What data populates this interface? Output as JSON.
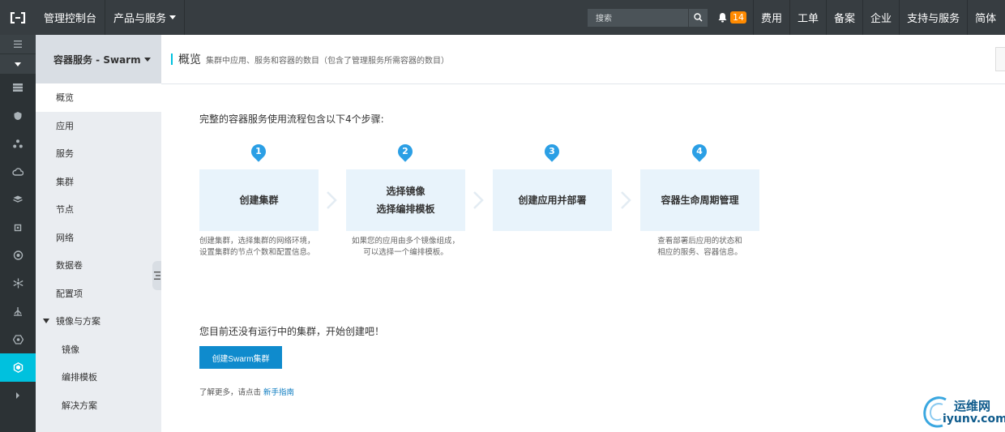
{
  "topbar": {
    "console": "管理控制台",
    "products": "产品与服务",
    "search_placeholder": "搜索",
    "notification_count": "14",
    "links": [
      "费用",
      "工单",
      "备案",
      "企业",
      "支持与服务",
      "简体"
    ]
  },
  "sidebar": {
    "title": "容器服务 - Swarm",
    "items": [
      "概览",
      "应用",
      "服务",
      "集群",
      "节点",
      "网络",
      "数据卷",
      "配置项"
    ],
    "group": "镜像与方案",
    "sub_items": [
      "镜像",
      "编排模板",
      "解决方案"
    ]
  },
  "page": {
    "title": "概览",
    "description": "集群中应用、服务和容器的数目（包含了管理服务所需容器的数目）"
  },
  "content": {
    "intro": "完整的容器服务使用流程包含以下4个步骤:",
    "steps": [
      {
        "num": "1",
        "title_lines": [
          "创建集群"
        ],
        "desc_lines": [
          "创建集群，选择集群的网络环境，",
          "设置集群的节点个数和配置信息。"
        ]
      },
      {
        "num": "2",
        "title_lines": [
          "选择镜像",
          "选择编排模板"
        ],
        "desc_lines": [
          "如果您的应用由多个镜像组成，",
          "可以选择一个编排模板。"
        ]
      },
      {
        "num": "3",
        "title_lines": [
          "创建应用并部署"
        ],
        "desc_lines": []
      },
      {
        "num": "4",
        "title_lines": [
          "容器生命周期管理"
        ],
        "desc_lines": [
          "查看部署后应用的状态和",
          "相应的服务、容器信息。"
        ]
      }
    ],
    "no_cluster": "您目前还没有运行中的集群，开始创建吧！",
    "create_button": "创建Swarm集群",
    "learn_more": "了解更多，请点击",
    "guide_link": "新手指南"
  },
  "watermark": {
    "cn": "运维网",
    "en": "iyunv.com"
  },
  "colors": {
    "topbar": "#373d41",
    "rail": "#2c3235",
    "accent": "#00c1de",
    "step_num": "#2b9fe5",
    "button": "#0f8bcd",
    "badge": "#ff8a00"
  }
}
